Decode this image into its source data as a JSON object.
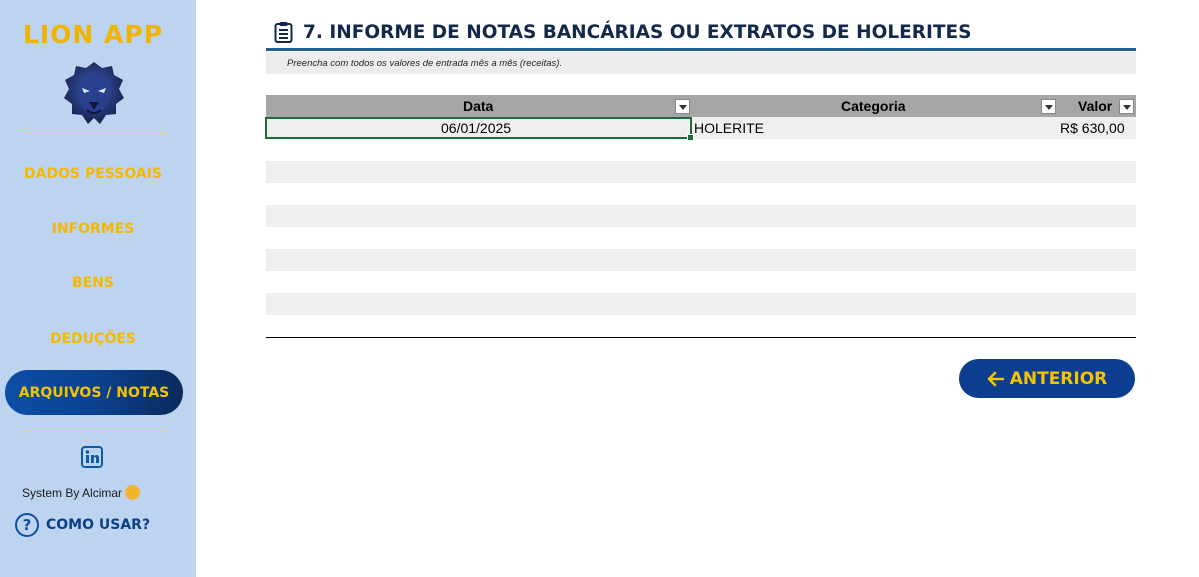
{
  "sidebar": {
    "brand": "LION APP",
    "nav": [
      {
        "label": "DADOS PESSOAIS"
      },
      {
        "label": "INFORMES"
      },
      {
        "label": "BENS"
      },
      {
        "label": "DEDUÇÕES"
      }
    ],
    "active_nav": "ARQUIVOS / NOTAS",
    "system_by": "System By Alcimar",
    "how_to": "COMO USAR?",
    "icons": [
      "lion-logo",
      "linkedin-icon",
      "help-icon",
      "hug-emoji"
    ]
  },
  "main": {
    "title": "7. INFORME DE NOTAS BANCÁRIAS OU EXTRATOS DE HOLERITES",
    "hint": "Preencha com todos os valores de entrada mês a mês (receitas).",
    "table": {
      "headers": {
        "data": "Data",
        "categoria": "Categoria",
        "valor": "Valor"
      },
      "rows": [
        {
          "data": "06/01/2025",
          "categoria": "HOLERITE",
          "valor": "R$ 630,00"
        }
      ]
    },
    "prev_button": "ANTERIOR"
  },
  "colors": {
    "sidebar_bg": "#bcd4ef",
    "accent_yellow": "#f5b800",
    "button_blue": "#0c3d8f",
    "header_gray": "#a6a6a6"
  }
}
